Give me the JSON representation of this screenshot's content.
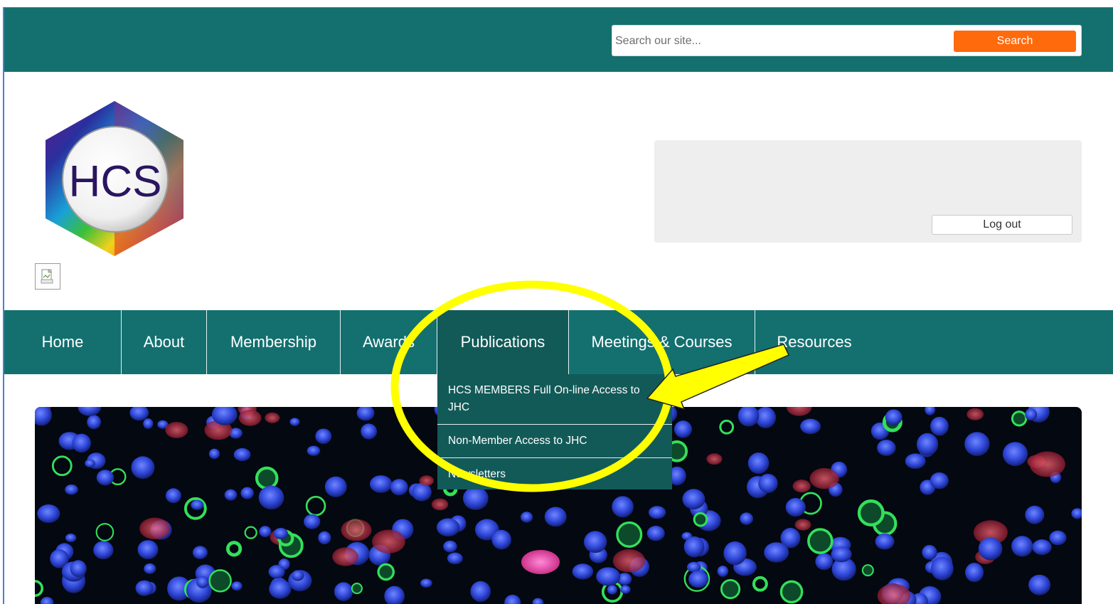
{
  "search": {
    "placeholder": "Search our site...",
    "button_label": "Search"
  },
  "logo": {
    "text": "HCS"
  },
  "account": {
    "logout_label": "Log out"
  },
  "nav": {
    "items": [
      {
        "label": "Home"
      },
      {
        "label": "About"
      },
      {
        "label": "Membership"
      },
      {
        "label": "Awards"
      },
      {
        "label": "Publications"
      },
      {
        "label": "Meetings & Courses"
      },
      {
        "label": "Resources"
      }
    ],
    "active": "Publications"
  },
  "publications_menu": {
    "items": [
      {
        "label": "HCS MEMBERS Full On-line Access to JHC"
      },
      {
        "label": "Non-Member Access to JHC"
      },
      {
        "label": "Newsletters"
      }
    ]
  },
  "colors": {
    "header_teal": "#13706f",
    "active_nav": "#125a58",
    "search_button": "#ff6a0c",
    "annotation": "#ffff00"
  },
  "icons": {
    "broken_image": "broken-image-icon"
  }
}
